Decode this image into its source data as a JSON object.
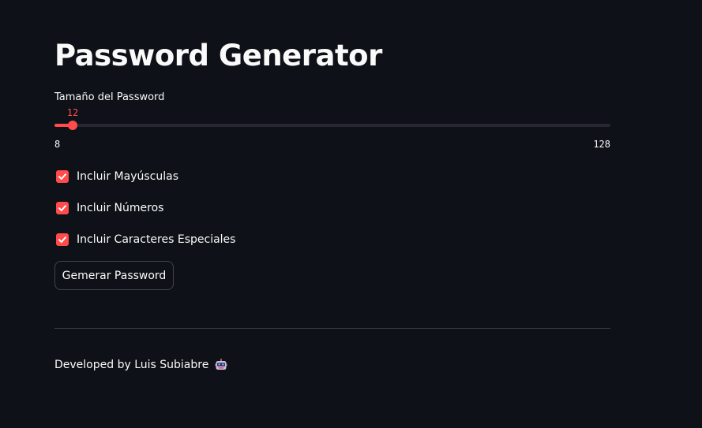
{
  "app": {
    "title": "Password Generator"
  },
  "slider": {
    "label": "Tamaño del Password",
    "value": "12",
    "min": "8",
    "max": "128",
    "accent": "#ff4b4b",
    "fraction": 0.0333
  },
  "options": [
    {
      "label": "Incluir Mayúsculas",
      "checked": true
    },
    {
      "label": "Incluir Números",
      "checked": true
    },
    {
      "label": "Incluir Caracteres Especiales",
      "checked": true
    }
  ],
  "button": {
    "label": "Gemerar Password"
  },
  "footer": {
    "text": "Developed by Luis Subiabre",
    "icon": "robot-icon"
  },
  "colors": {
    "background": "#0e1117",
    "accent": "#ff4b4b",
    "text": "#fafafa"
  }
}
